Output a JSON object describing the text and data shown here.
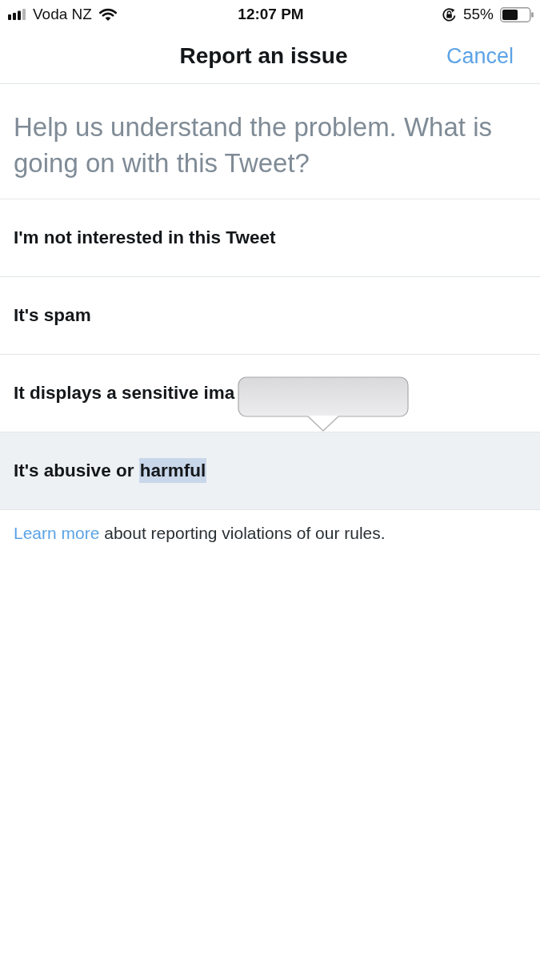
{
  "status_bar": {
    "carrier": "Voda NZ",
    "time": "12:07 PM",
    "battery": "55%"
  },
  "nav": {
    "title": "Report an issue",
    "cancel": "Cancel"
  },
  "prompt": "Help us understand the problem. What is going on with this Tweet?",
  "options": [
    {
      "label": "I'm not interested in this Tweet",
      "selected": false
    },
    {
      "label": "It's spam",
      "selected": false
    },
    {
      "label": "It displays a sensitive ima",
      "selected": false
    },
    {
      "label": "It's abusive or",
      "text_selection": "harmful",
      "selected": true
    }
  ],
  "edit_menu": {
    "shown": true
  },
  "footer": {
    "link": "Learn more",
    "text": "about reporting violations of our rules."
  }
}
